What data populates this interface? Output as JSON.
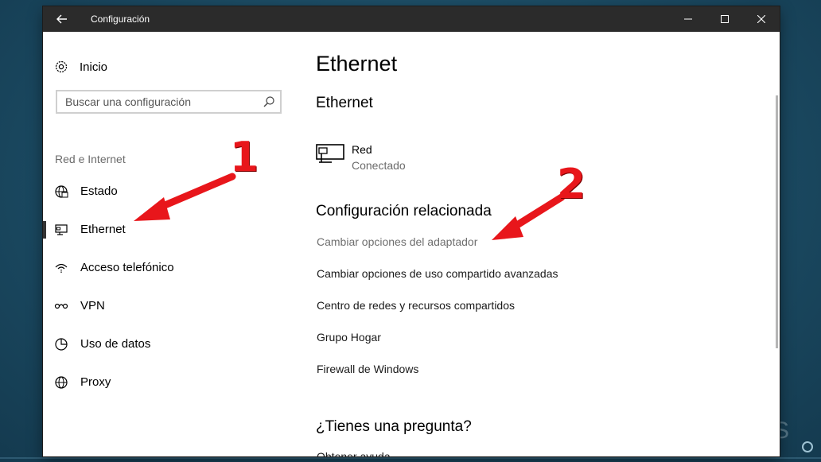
{
  "window": {
    "title": "Configuración"
  },
  "sidebar": {
    "home_label": "Inicio",
    "search_placeholder": "Buscar una configuración",
    "group_label": "Red e Internet",
    "items": [
      {
        "label": "Estado",
        "icon": "globe-status-icon"
      },
      {
        "label": "Ethernet",
        "icon": "ethernet-icon",
        "active": true
      },
      {
        "label": "Acceso telefónico",
        "icon": "dialup-icon"
      },
      {
        "label": "VPN",
        "icon": "vpn-icon"
      },
      {
        "label": "Uso de datos",
        "icon": "data-usage-icon"
      },
      {
        "label": "Proxy",
        "icon": "proxy-globe-icon"
      }
    ]
  },
  "main": {
    "page_title": "Ethernet",
    "section_title": "Ethernet",
    "network": {
      "name": "Red",
      "status": "Conectado"
    },
    "related_title": "Configuración relacionada",
    "related_links": [
      "Cambiar opciones del adaptador",
      "Cambiar opciones de uso compartido avanzadas",
      "Centro de redes y recursos compartidos",
      "Grupo Hogar",
      "Firewall de Windows"
    ],
    "question_title": "¿Tienes una pregunta?",
    "help_link": "Obtener ayuda"
  },
  "annotations": {
    "first": "1",
    "second": "2",
    "color": "#e8161b"
  },
  "colors": {
    "titlebar": "#2b2b2b",
    "accent_active": "#333333"
  }
}
